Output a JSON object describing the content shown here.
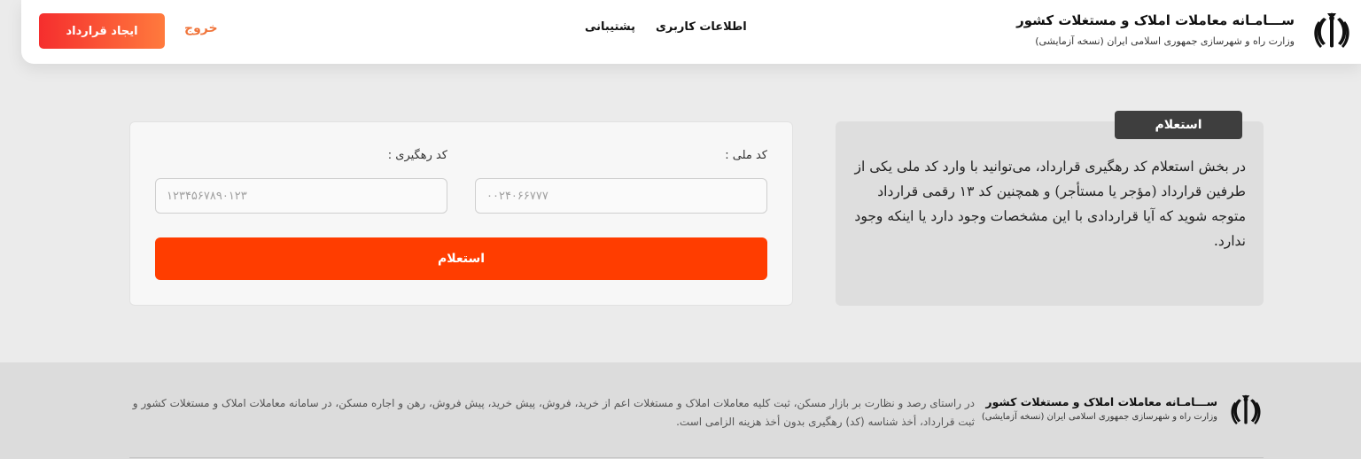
{
  "header": {
    "title": "ســـامـانه معاملات املاک و مستغلات کشور",
    "subtitle": "وزارت راه و شهرسازی جمهوری اسلامی ایران (نسخه آزمایشی)",
    "nav": {
      "user_info": "اطلاعات کاربری",
      "support": "پشتیبانی"
    },
    "logout": "خروج",
    "create_contract": "ایجاد قرارداد",
    "emblem_icon": "iran-emblem-icon"
  },
  "inquiry_info": {
    "badge": "استعلام",
    "text": "در بخش استعلام کد رهگیری قرارداد، می‌توانید با وارد کد ملی یکی از طرفین قرارداد (مؤجر یا مستأجر) و همچنین کد ۱۳ رقمی قرارداد متوجه شوید که آیا قراردادی با این مشخصات وجود دارد یا اینکه وجود ندارد."
  },
  "form": {
    "national_code_label": "کد ملی :",
    "national_code_placeholder": "۰۰۲۴۰۶۶۷۷۷",
    "tracking_code_label": "کد رهگیری :",
    "tracking_code_placeholder": "۱۲۳۴۵۶۷۸۹۰۱۲۳",
    "submit": "استعلام"
  },
  "footer": {
    "title": "ســـامـانه معاملات املاک و مستغلات کشور",
    "subtitle": "وزارت راه و شهرسازی جمهوری اسلامی ایران (نسخه آزمایشی)",
    "text": "در راستای رصد و نظارت بر بازار مسکن، ثبت کلیه معاملات املاک و مستغلات اعم از خرید، فروش، پیش خرید، پیش فروش، رهن و اجاره مسکن، در سامانه معاملات املاک و مستغلات کشور و ثبت قرارداد، أخذ شناسه (کد) رهگیری بدون أخذ هزینه الزامی است."
  },
  "colors": {
    "accent": "#ff3d00",
    "create_gradient_start": "#f52e2e",
    "create_gradient_end": "#ff7a3d",
    "logout": "#f0743a",
    "badge_bg": "#3e3e3e"
  }
}
